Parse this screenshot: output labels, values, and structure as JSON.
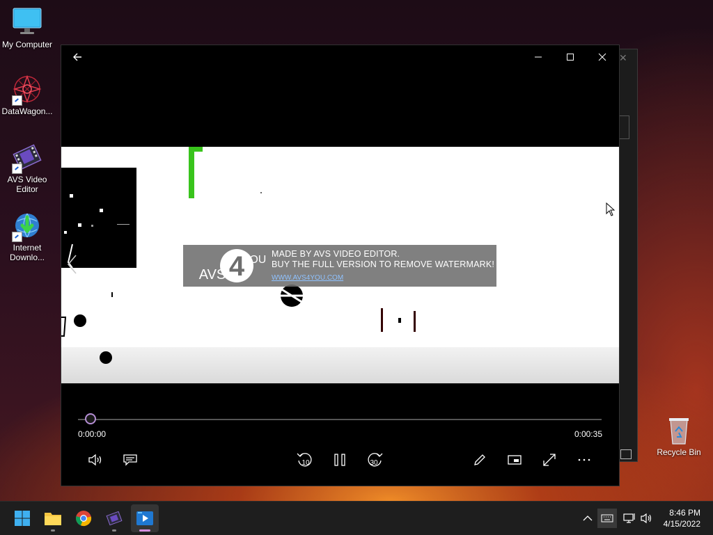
{
  "desktop": {
    "icons": [
      {
        "label": "My Computer"
      },
      {
        "label": "DataWagon..."
      },
      {
        "label": "AVS Video Editor"
      },
      {
        "label": "Internet Downlo..."
      },
      {
        "label": "Recycle Bin"
      }
    ]
  },
  "player": {
    "watermark": {
      "logo_main": "AVS",
      "logo_num": "4",
      "logo_you": "YOU",
      "line1": "MADE BY AVS VIDEO EDITOR.",
      "line2": "BUY THE FULL VERSION TO REMOVE WATERMARK!",
      "url": "WWW.AVS4YOU.COM"
    },
    "time_current": "0:00:00",
    "time_total": "0:00:35",
    "progress": 0.0,
    "skip_back_label": "10",
    "skip_forward_label": "30"
  },
  "taskbar": {
    "apps": [
      "start-icon",
      "file-explorer-icon",
      "chrome-icon",
      "avs-editor-icon",
      "media-player-icon"
    ],
    "active_app": "media-player-icon",
    "time": "8:46 PM",
    "date": "4/15/2022"
  },
  "colors": {
    "accent": "#b68fd6",
    "taskbar": "#1e1e1e"
  }
}
